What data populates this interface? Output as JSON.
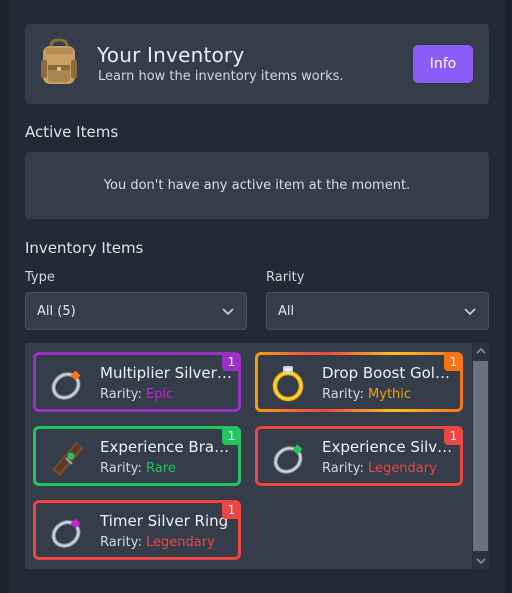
{
  "header": {
    "title": "Your Inventory",
    "subtitle": "Learn how the inventory items works.",
    "info_label": "Info",
    "icon": "backpack-icon"
  },
  "active": {
    "label": "Active Items",
    "empty_message": "You don't have any active item at the moment."
  },
  "inventory": {
    "label": "Inventory Items",
    "filters": {
      "type": {
        "label": "Type",
        "value": "All (5)"
      },
      "rarity": {
        "label": "Rarity",
        "value": "All"
      }
    },
    "rarity_prefix": "Rarity:",
    "items": [
      {
        "name": "Multiplier Silver Ring",
        "rarity": "Epic",
        "count": "1",
        "color": "#9b30c4",
        "icon": "silver-ring-icon"
      },
      {
        "name": "Drop Boost Gold Ring",
        "rarity": "Mythic",
        "count": "1",
        "color": "#f97316",
        "icon": "gold-ring-icon"
      },
      {
        "name": "Experience Bracelet",
        "rarity": "Rare",
        "count": "1",
        "color": "#22c55e",
        "icon": "bracelet-icon"
      },
      {
        "name": "Experience Silver Ring",
        "rarity": "Legendary",
        "count": "1",
        "color": "#ef4444",
        "icon": "silver-ring-icon"
      },
      {
        "name": "Timer Silver Ring",
        "rarity": "Legendary",
        "count": "1",
        "color": "#ef4444",
        "icon": "silver-ring-icon"
      }
    ]
  },
  "colors": {
    "accent": "#8b5cf6",
    "epic": "#c026d3",
    "mythic": "#f59e0b",
    "rare": "#22c55e",
    "legendary": "#ef4444"
  }
}
